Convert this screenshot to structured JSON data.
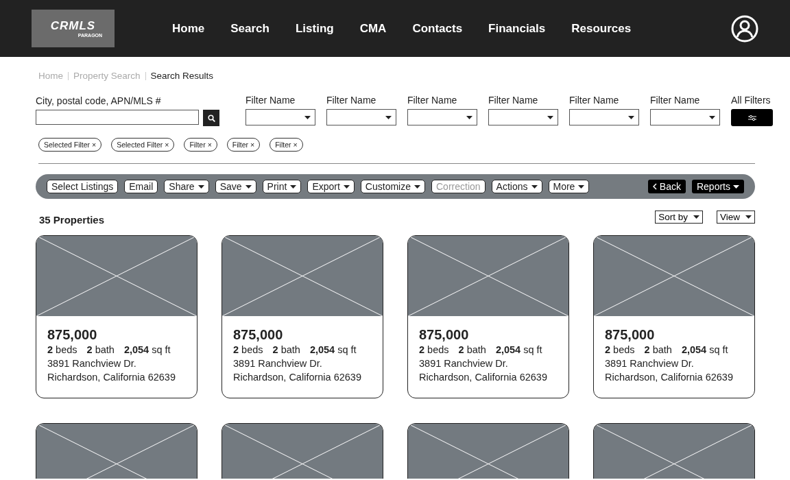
{
  "header": {
    "logo": {
      "text": "CRMLS",
      "subtext": "PARAGON"
    },
    "nav": [
      {
        "label": "Home"
      },
      {
        "label": "Search"
      },
      {
        "label": "Listing"
      },
      {
        "label": "CMA"
      },
      {
        "label": "Contacts"
      },
      {
        "label": "Financials"
      },
      {
        "label": "Resources"
      }
    ]
  },
  "breadcrumbs": [
    {
      "label": "Home",
      "current": false
    },
    {
      "label": "Property Search",
      "current": false
    },
    {
      "label": "Search Results",
      "current": true
    }
  ],
  "search": {
    "label": "City, postal code, APN/MLS #"
  },
  "filters": [
    {
      "label": "Filter Name"
    },
    {
      "label": "Filter Name"
    },
    {
      "label": "Filter Name"
    },
    {
      "label": "Filter Name"
    },
    {
      "label": "Filter Name"
    },
    {
      "label": "Filter Name"
    }
  ],
  "all_filters": {
    "label": "All Filters"
  },
  "chips": [
    {
      "label": "Selected Filter",
      "remove": "×"
    },
    {
      "label": "Selected Filter",
      "remove": "×"
    },
    {
      "label": "Filter",
      "remove": "×"
    },
    {
      "label": "Filter",
      "remove": "×"
    },
    {
      "label": "Filter",
      "remove": "×"
    }
  ],
  "toolbar": [
    {
      "label": "Select Listings",
      "kind": "plain",
      "disabled": false
    },
    {
      "label": "Email",
      "kind": "plain",
      "disabled": false
    },
    {
      "label": "Share",
      "kind": "dropdown",
      "disabled": false
    },
    {
      "label": "Save",
      "kind": "dropdown",
      "disabled": false
    },
    {
      "label": "Print",
      "kind": "dropdown",
      "disabled": false
    },
    {
      "label": "Export",
      "kind": "dropdown",
      "disabled": false
    },
    {
      "label": "Customize",
      "kind": "dropdown",
      "disabled": false
    },
    {
      "label": "Correction",
      "kind": "plain",
      "disabled": true
    },
    {
      "label": "Actions",
      "kind": "dropdown",
      "disabled": false
    },
    {
      "label": "More",
      "kind": "dropdown",
      "disabled": false
    }
  ],
  "toolbar_right": [
    {
      "label": "Back",
      "kind": "back"
    },
    {
      "label": "Reports",
      "kind": "dropdown"
    }
  ],
  "results": {
    "count": "35 Properties",
    "sort": "Sort by",
    "view": "View"
  },
  "listings": [
    {
      "kind": "full",
      "price": "875,000",
      "beds": "**2** beds",
      "bath": "**2** bath",
      "area": "**2,054** sq ft",
      "street": "3891 Ranchview Dr.",
      "city": "Richardson, California 62639"
    },
    {
      "kind": "full",
      "price": "875,000",
      "beds": "**2** beds",
      "bath": "**2** bath",
      "area": "**2,054** sq ft",
      "street": "3891 Ranchview Dr.",
      "city": "Richardson, California 62639"
    },
    {
      "kind": "full",
      "price": "875,000",
      "beds": "**2** beds",
      "bath": "**2** bath",
      "area": "**2,054** sq ft",
      "street": "3891 Ranchview Dr.",
      "city": "Richardson, California 62639"
    },
    {
      "kind": "full",
      "price": "875,000",
      "beds": "**2** beds",
      "bath": "**2** bath",
      "area": "**2,054** sq ft",
      "street": "3891 Ranchview Dr.",
      "city": "Richardson, California 62639"
    },
    {
      "kind": "image_only"
    },
    {
      "kind": "image_only"
    },
    {
      "kind": "image_only"
    },
    {
      "kind": "image_only"
    }
  ]
}
